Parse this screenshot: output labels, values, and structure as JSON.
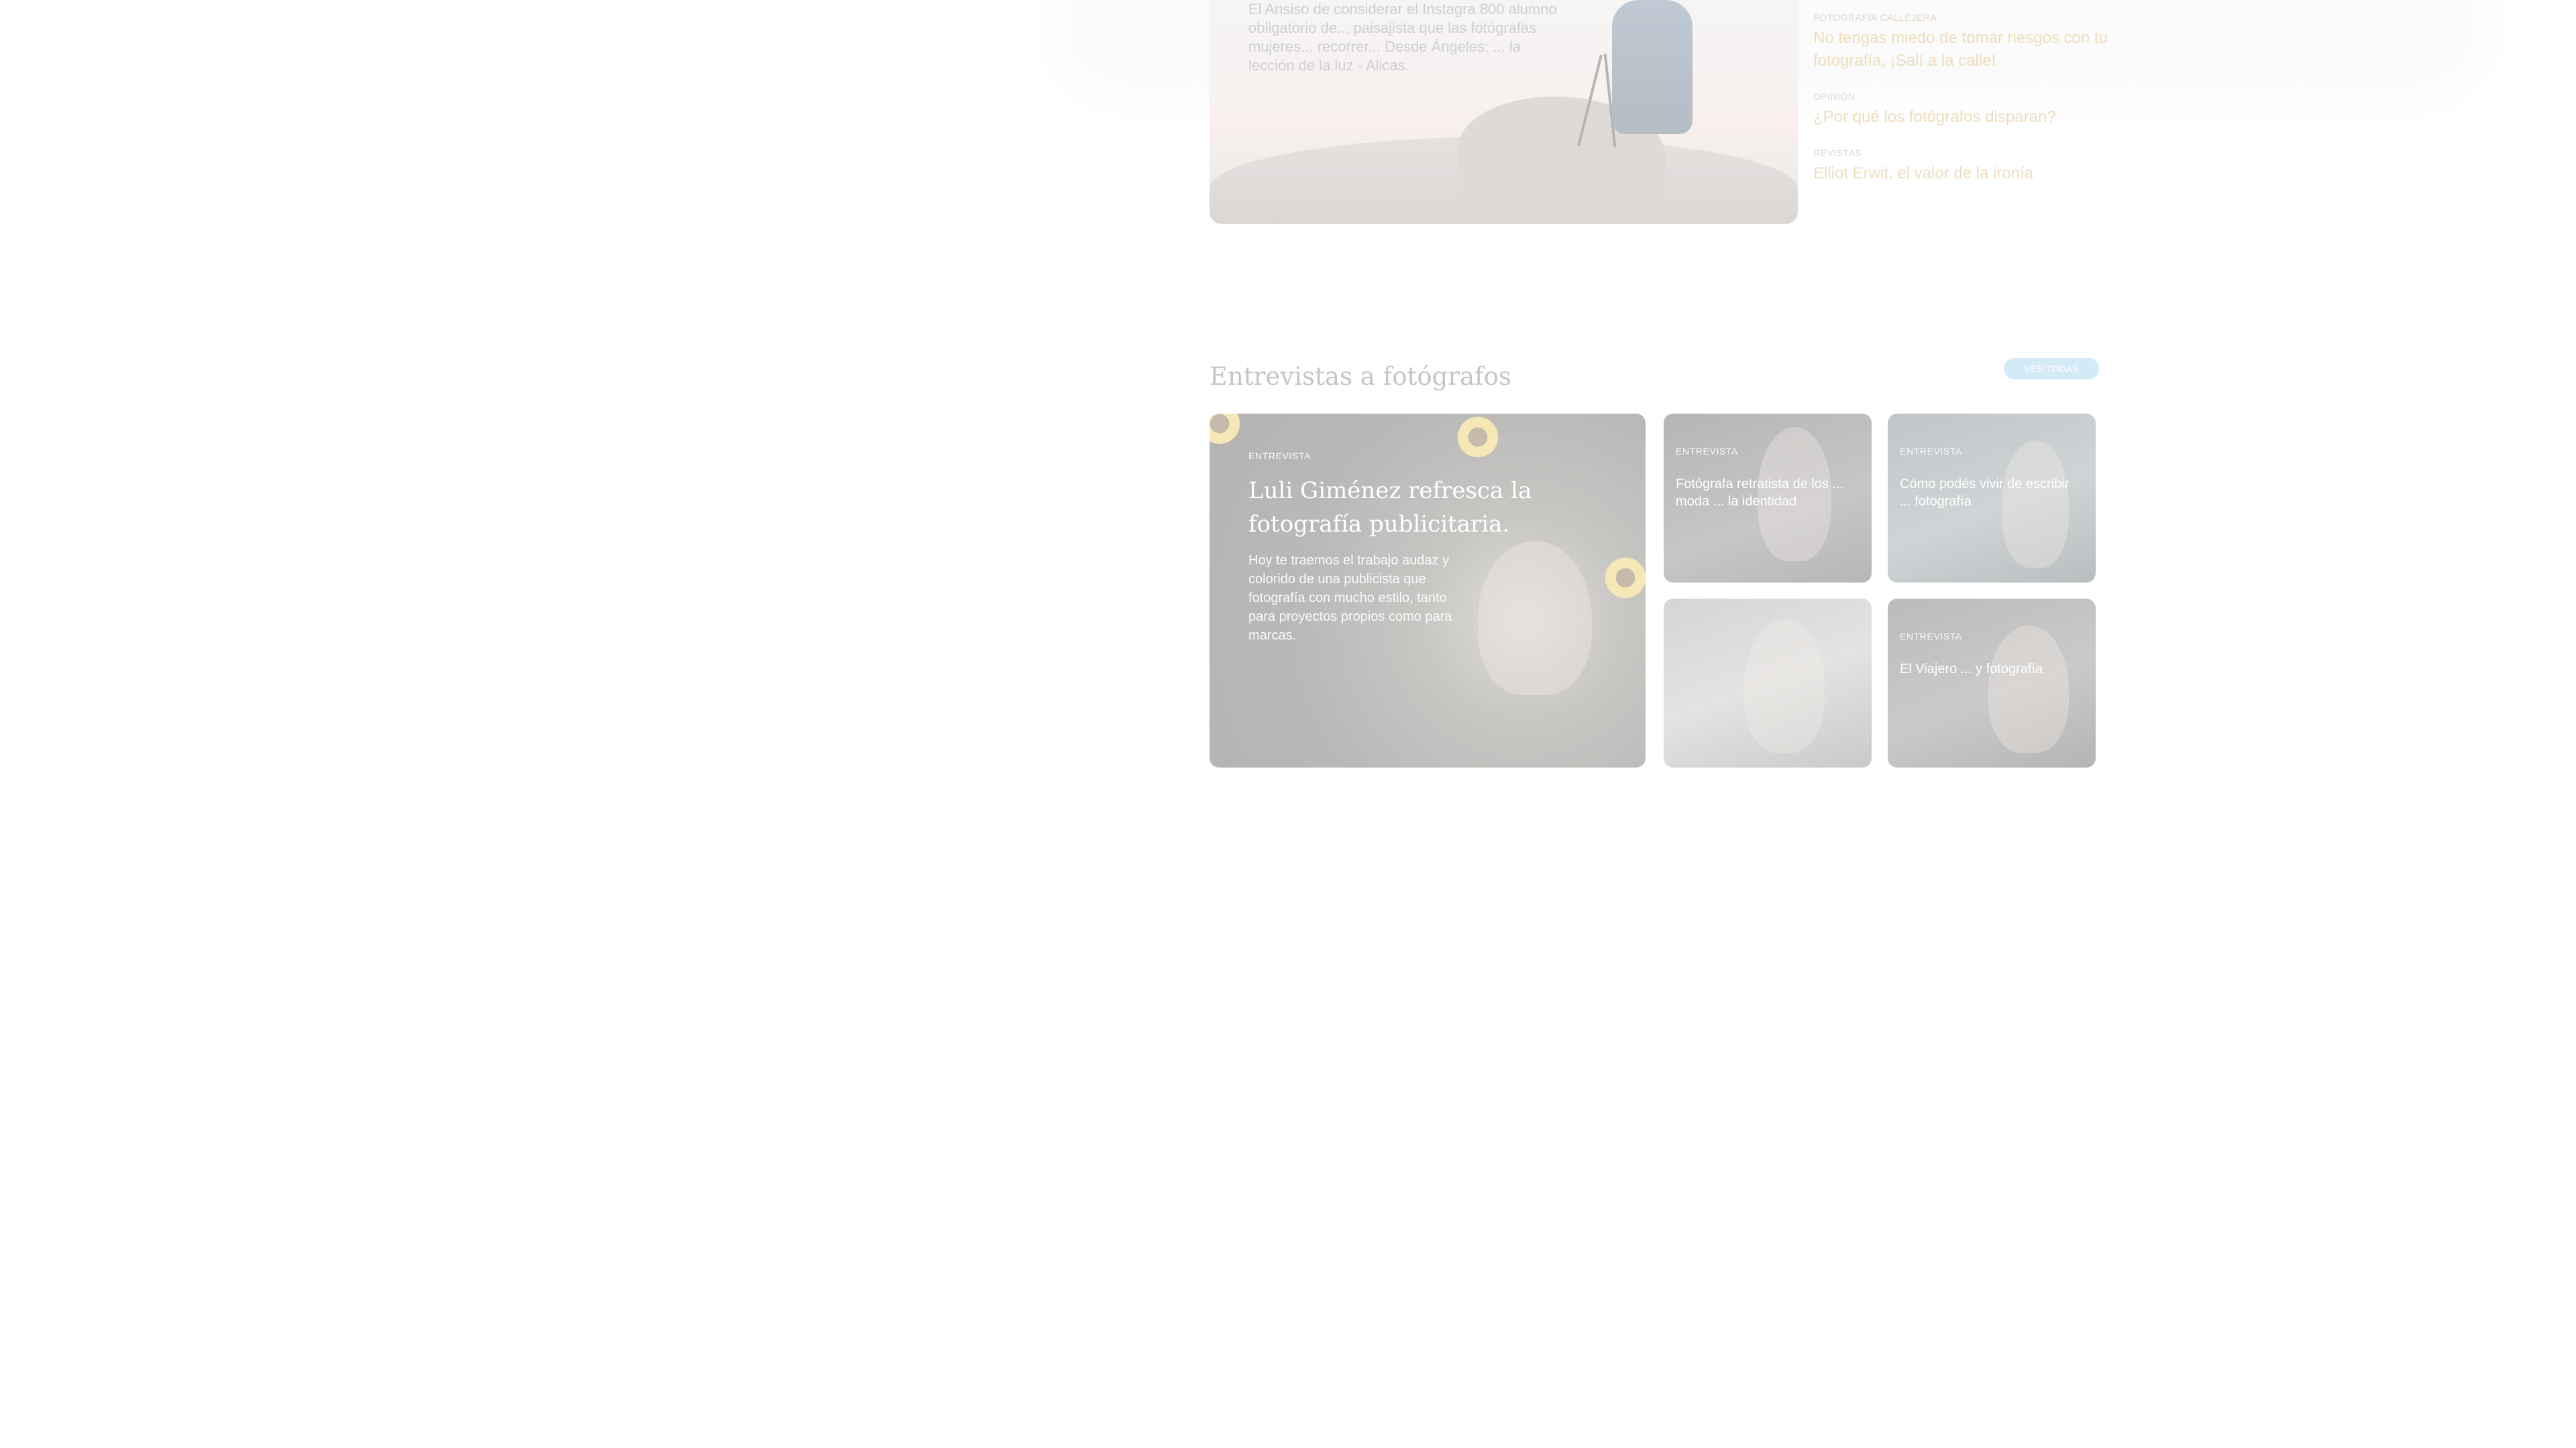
{
  "hero": {
    "description": "El Ansiso de considerar el Instagra 800 alumno obligatorio de... paisajista que las fotógrafas mujeres... recorrer... Desde Ángeles: ... la lección de la luz - Alicas."
  },
  "related": [
    {
      "category": "FOTOGRAFÍA CALLEJERA",
      "title": "No tengas miedo de tomar riesgos con tu fotografía, ¡Salí a la calle!"
    },
    {
      "category": "OPINIÓN",
      "title": "¿Por qué los fotógrafos disparan?"
    },
    {
      "category": "REVISTAS",
      "title": "Elliot Erwit, el valor de la ironía"
    }
  ],
  "section": {
    "title": "Entrevistas a fotógrafos",
    "see_all": "VER TODAS"
  },
  "cards": {
    "featured": {
      "category": "ENTREVISTA",
      "title": "Luli Giménez refresca la fotografía publicitaria.",
      "description": "Hoy te traemos el trabajo audaz y colorido de una publicista que fotografía con mucho estilo, tanto para proyectos propios como para marcas."
    },
    "small": [
      {
        "category": "ENTREVISTA",
        "title": "Fotógrafa retratista de los ... moda ... la identidad"
      },
      {
        "category": "ENTREVISTA",
        "title": "Cómo podés vivir de escribir ... fotografía"
      },
      {
        "category": "",
        "title": ""
      },
      {
        "category": "ENTREVISTA",
        "title": "El Viajero ... y fotografía"
      }
    ]
  }
}
